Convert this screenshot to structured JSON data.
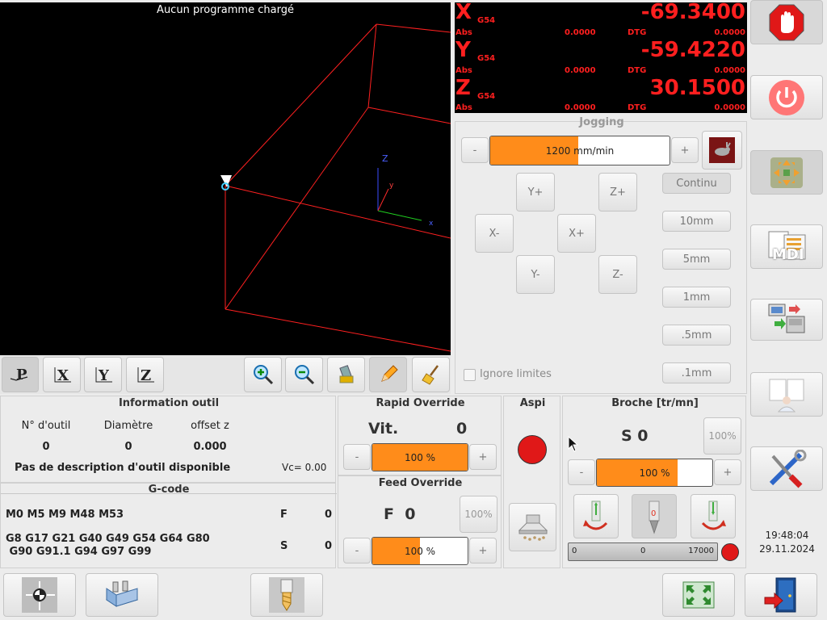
{
  "viewport": {
    "message": "Aucun programme chargé"
  },
  "dro": {
    "x": {
      "axis": "X",
      "coord": "G54",
      "value": "-69.3400",
      "abs_label": "Abs",
      "abs": "0.0000",
      "dtg_label": "DTG",
      "dtg": "0.0000"
    },
    "y": {
      "axis": "Y",
      "coord": "G54",
      "value": "-59.4220",
      "abs_label": "Abs",
      "abs": "0.0000",
      "dtg_label": "DTG",
      "dtg": "0.0000"
    },
    "z": {
      "axis": "Z",
      "coord": "G54",
      "value": "30.1500",
      "abs_label": "Abs",
      "abs": "0.0000",
      "dtg_label": "DTG",
      "dtg": "0.0000"
    }
  },
  "jogging": {
    "title": "Jogging",
    "minus": "-",
    "plus": "+",
    "rate": "1200 mm/min",
    "rate_fraction": 0.49,
    "buttons": {
      "yplus": "Y+",
      "zplus": "Z+",
      "xminus": "X-",
      "xplus": "X+",
      "yminus": "Y-",
      "zminus": "Z-"
    },
    "increments": [
      "Continu",
      "10mm",
      "5mm",
      "1mm",
      ".5mm",
      ".1mm"
    ],
    "ignore_limits": "Ignore limites"
  },
  "tool_info": {
    "title": "Information outil",
    "headers": [
      "N° d'outil",
      "Diamètre",
      "offset z"
    ],
    "values": [
      "0",
      "0",
      "0.000"
    ],
    "description": "Pas de description d'outil disponible",
    "vc": "Vc= 0.00"
  },
  "rapid": {
    "title": "Rapid Override",
    "label": "Vit.",
    "value": "0",
    "minus": "-",
    "plus": "+",
    "bar": "100 %",
    "fraction": 1.0
  },
  "feed": {
    "title": "Feed Override",
    "label": "F  0",
    "reset": "100%",
    "minus": "-",
    "plus": "+",
    "bar": "100 %",
    "fraction": 0.5
  },
  "aspi": {
    "title": "Aspi"
  },
  "spindle": {
    "title": "Broche [tr/mn]",
    "value": "S 0",
    "reset": "100%",
    "minus": "-",
    "plus": "+",
    "bar": "100 %",
    "fraction": 0.7,
    "min": "0",
    "current": "0",
    "max": "17000"
  },
  "gcode": {
    "title": "G-code",
    "mcodes": "M0 M5 M9 M48 M53",
    "f_label": "F",
    "f_value": "0",
    "gcodes_line1": "G8 G17 G21 G40 G49 G54 G64 G80",
    "gcodes_line2": " G90 G91.1 G94 G97 G99",
    "s_label": "S",
    "s_value": "0"
  },
  "clock": {
    "time": "19:48:04",
    "date": "29.11.2024"
  },
  "sidebar": {
    "mdi": "MDI"
  },
  "colors": {
    "accent": "#ff8c1a",
    "dro_red": "#ff1f1f",
    "estop": "#e01818"
  }
}
